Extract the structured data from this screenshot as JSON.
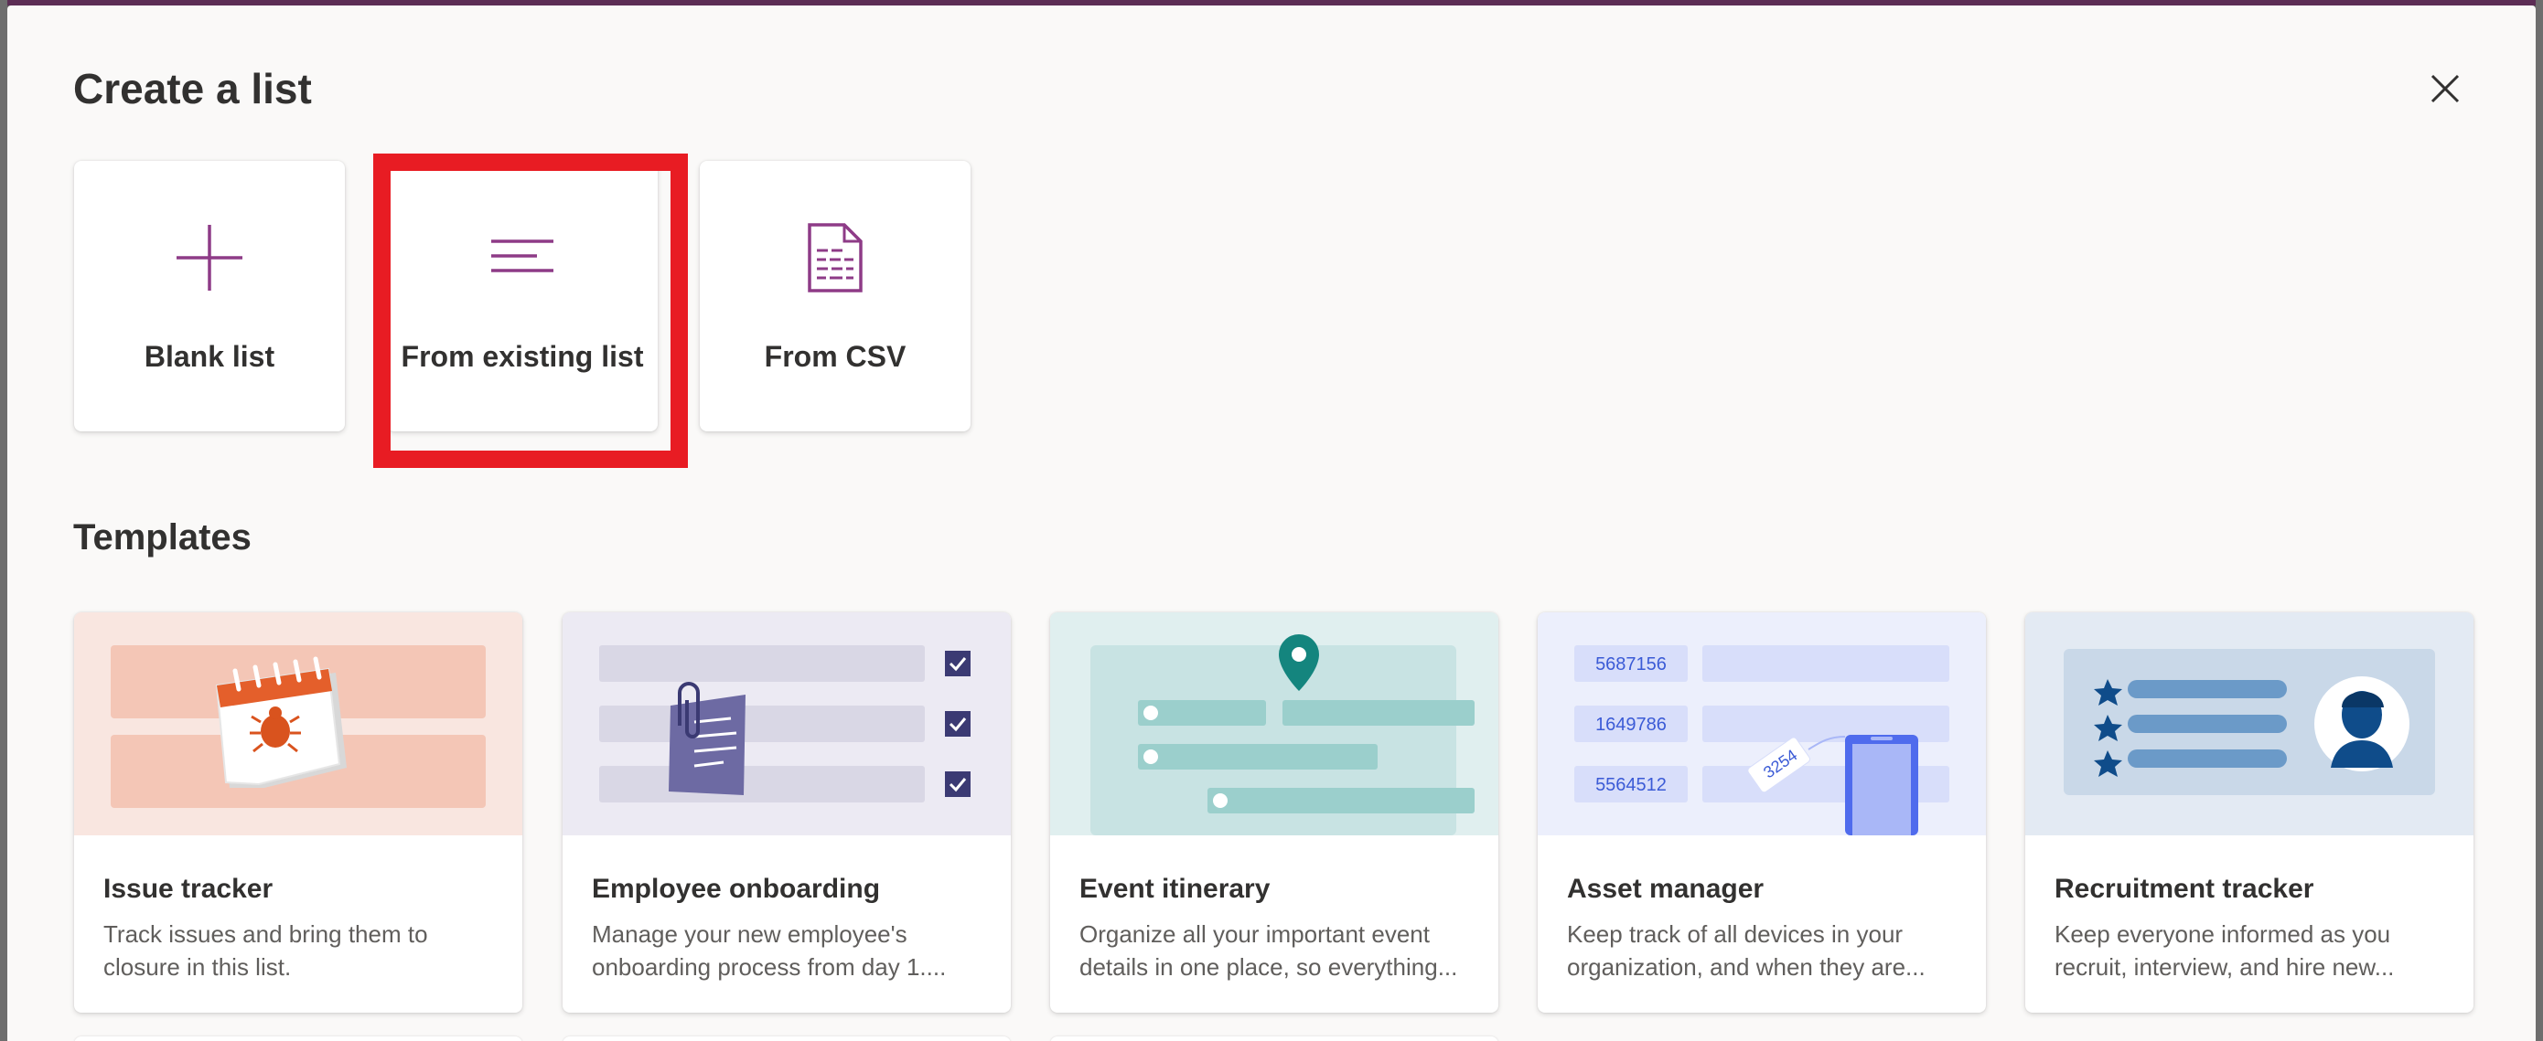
{
  "dialog": {
    "title": "Create a list",
    "close_icon": "close-icon"
  },
  "create_options": [
    {
      "label": "Blank list",
      "icon": "plus-icon"
    },
    {
      "label": "From existing list",
      "icon": "lines-icon"
    },
    {
      "label": "From CSV",
      "icon": "csv-document-icon"
    }
  ],
  "templates_section": {
    "title": "Templates",
    "items": [
      {
        "title": "Issue tracker",
        "description": "Track issues and bring them to closure in this list."
      },
      {
        "title": "Employee onboarding",
        "description": "Manage your new employee's onboarding process from day 1...."
      },
      {
        "title": "Event itinerary",
        "description": "Organize all your important event details in one place, so everything..."
      },
      {
        "title": "Asset manager",
        "description": "Keep track of all devices in your organization, and when they are..."
      },
      {
        "title": "Recruitment tracker",
        "description": "Keep everyone informed as you recruit, interview, and hire new..."
      }
    ],
    "asset_thumb": {
      "ids": [
        "5687156",
        "1649786",
        "5564512"
      ],
      "tag": "3254"
    }
  },
  "colors": {
    "accent": "#8e3b87",
    "highlight": "#e81c23"
  }
}
